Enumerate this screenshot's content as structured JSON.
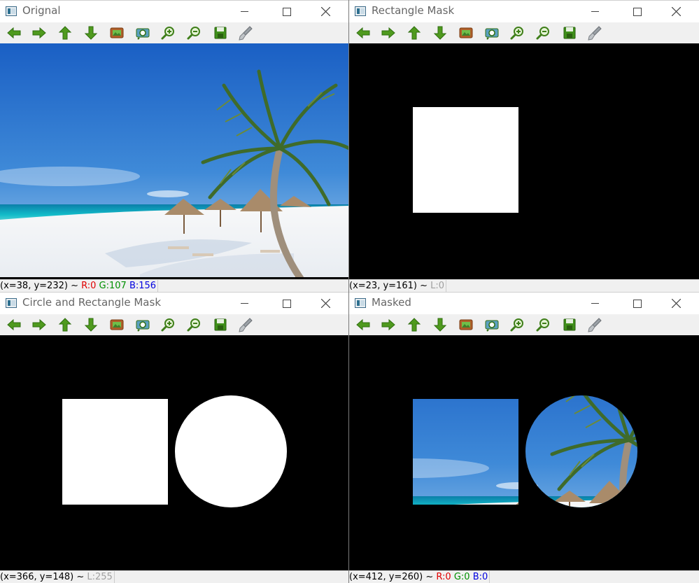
{
  "windows": [
    {
      "title": "Orignal",
      "status": {
        "coords": "(x=38, y=232) ~",
        "r": "R:0",
        "g": "G:107",
        "b": "B:156"
      }
    },
    {
      "title": "Rectangle Mask",
      "status": {
        "coords": "(x=23, y=161) ~",
        "l": "L:0"
      }
    },
    {
      "title": "Circle and Rectangle Mask",
      "status": {
        "coords": "(x=366, y=148) ~",
        "l": "L:255"
      }
    },
    {
      "title": "Masked",
      "status": {
        "coords": "(x=412, y=260) ~",
        "r": "R:0",
        "g": "G:0",
        "b": "B:0"
      }
    }
  ],
  "toolbar_icons": [
    "arrow-left-icon",
    "arrow-right-icon",
    "arrow-up-icon",
    "arrow-down-icon",
    "image-icon",
    "zoom-fit-icon",
    "zoom-in-icon",
    "zoom-out-icon",
    "save-icon",
    "properties-brush-icon"
  ],
  "colors": {
    "sky_top": "#1a63c6",
    "sky_bottom": "#9cc8ea",
    "sea": "#10b6c6",
    "sand": "#f4f6f8",
    "status_r": "#e00000",
    "status_g": "#009000",
    "status_b": "#0000e0"
  }
}
